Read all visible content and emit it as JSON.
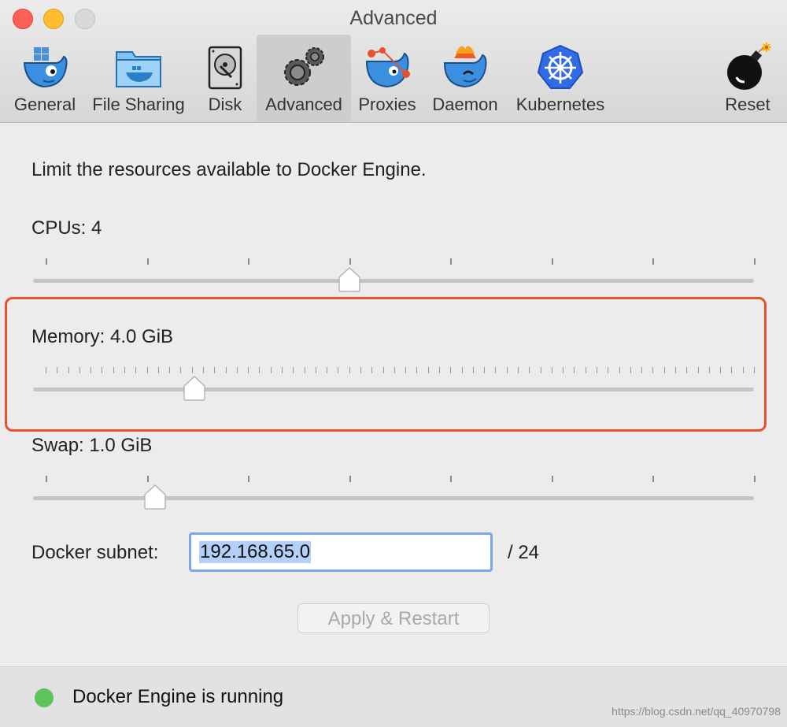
{
  "window": {
    "title": "Advanced"
  },
  "tabs": [
    {
      "label": "General",
      "icon": "docker-whale-icon"
    },
    {
      "label": "File Sharing",
      "icon": "folder-whale-icon"
    },
    {
      "label": "Disk",
      "icon": "hard-disk-icon"
    },
    {
      "label": "Advanced",
      "icon": "gears-icon",
      "active": true
    },
    {
      "label": "Proxies",
      "icon": "whale-proxies-icon"
    },
    {
      "label": "Daemon",
      "icon": "whale-daemon-icon"
    },
    {
      "label": "Kubernetes",
      "icon": "kubernetes-icon"
    },
    {
      "label": "Reset",
      "icon": "bomb-icon"
    }
  ],
  "main": {
    "intro": "Limit the resources available to Docker Engine.",
    "cpus": {
      "label": "CPUs: 4",
      "value": 4,
      "min": 1,
      "max": 8
    },
    "memory": {
      "label": "Memory: 4.0 GiB",
      "value_gib": 4.0,
      "fraction": 0.21
    },
    "swap": {
      "label": "Swap: 1.0 GiB",
      "value_gib": 1.0,
      "fraction": 0.154
    },
    "subnet": {
      "label": "Docker subnet:",
      "value": "192.168.65.0",
      "suffix": "/ 24"
    },
    "apply_label": "Apply & Restart"
  },
  "status": {
    "text": "Docker Engine is running",
    "color": "#5ec35a"
  },
  "watermark": "https://blog.csdn.net/qq_40970798",
  "colors": {
    "highlight": "#e8512b",
    "focus": "#7aa6ec"
  }
}
